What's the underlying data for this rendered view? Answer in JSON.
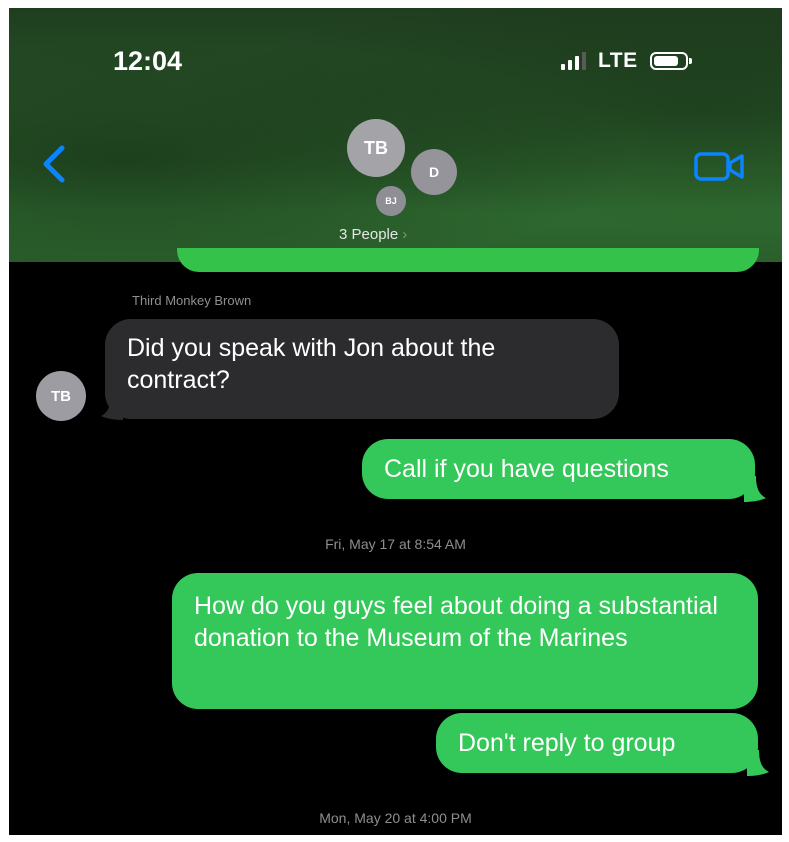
{
  "status_bar": {
    "time": "12:04",
    "network": "LTE"
  },
  "header": {
    "avatars": [
      "TB",
      "D",
      "BJ"
    ],
    "group_label": "3 People",
    "chevron": "›"
  },
  "messages": [
    {
      "type": "received",
      "sender": "Third Monkey Brown",
      "avatar": "TB",
      "text": "Did you speak with Jon about the contract?"
    },
    {
      "type": "sent",
      "text": "Call if you have questions"
    },
    {
      "type": "timestamp",
      "text": "Fri, May 17 at 8:54 AM"
    },
    {
      "type": "sent",
      "text": "How do you guys feel about doing a substantial donation to the Museum of the Marines"
    },
    {
      "type": "sent",
      "text": "Don't reply to group"
    },
    {
      "type": "timestamp",
      "text": "Mon, May 20 at 4:00 PM"
    }
  ],
  "icons": {
    "back": "chevron-left-icon",
    "video": "video-camera-icon",
    "signal": "cellular-signal-icon",
    "battery": "battery-icon"
  },
  "colors": {
    "sent_bubble": "#34c759",
    "received_bubble": "#2c2c2e",
    "accent_blue": "#0a84ff",
    "background": "#000000"
  }
}
